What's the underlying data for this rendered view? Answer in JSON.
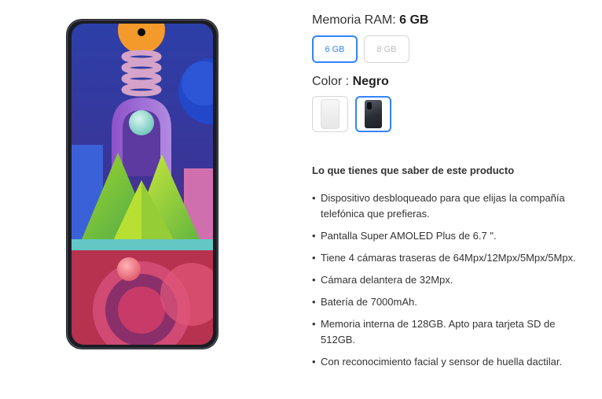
{
  "product_image": {
    "icon": "phone-image"
  },
  "ram": {
    "label": "Memoria RAM: ",
    "selected": "6 GB",
    "options": [
      "6 GB",
      "8 GB"
    ]
  },
  "color": {
    "label": "Color : ",
    "selected": "Negro",
    "options": [
      {
        "name": "Blanco",
        "swatch": "#f2f2f2"
      },
      {
        "name": "Negro",
        "swatch": "#2b2e35"
      }
    ]
  },
  "features": {
    "title": "Lo que tienes que saber de este producto",
    "items": [
      "Dispositivo desbloqueado para que elijas la compañía telefónica que prefieras.",
      "Pantalla Super AMOLED Plus de 6.7 \".",
      "Tiene 4 cámaras traseras de 64Mpx/12Mpx/5Mpx/5Mpx.",
      "Cámara delantera de 32Mpx.",
      "Batería de 7000mAh.",
      "Memoria interna de 128GB. Apto para tarjeta SD de 512GB.",
      "Con reconocimiento facial y sensor de huella dactilar."
    ]
  },
  "colors": {
    "accent": "#3483fa",
    "text": "#333333",
    "disabled": "#bdbdbd"
  }
}
